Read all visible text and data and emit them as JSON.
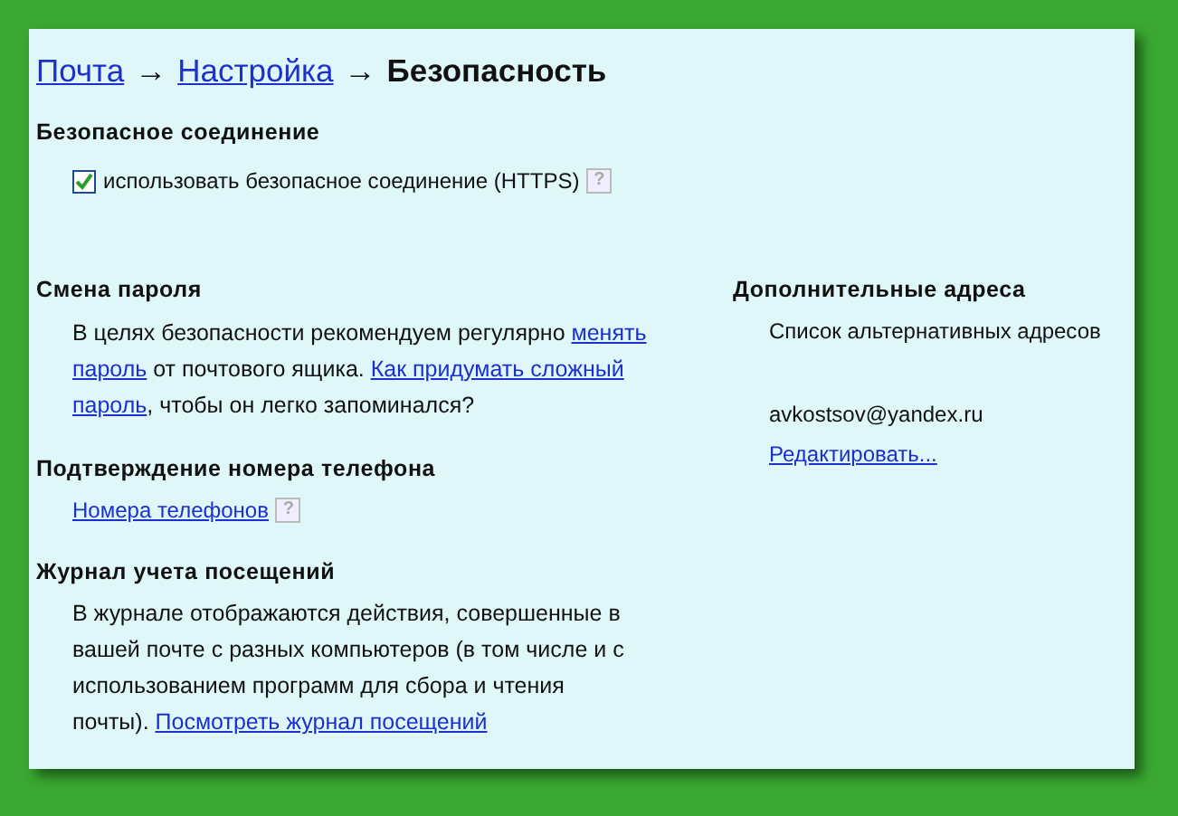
{
  "breadcrumb": [
    {
      "text": "Почта",
      "kind": "link"
    },
    {
      "text": "→",
      "kind": "separator"
    },
    {
      "text": "Настройка",
      "kind": "link"
    },
    {
      "text": "→",
      "kind": "separator"
    },
    {
      "text": "Безопасность",
      "kind": "current"
    }
  ],
  "secure_connection": {
    "heading": "Безопасное соединение",
    "checkbox": {
      "label": "использовать безопасное соединение (HTTPS)",
      "checked": true
    },
    "help": "?"
  },
  "password": {
    "heading": "Смена пароля",
    "paragraph": [
      [
        {
          "text": "В целях безопасности рекомендуем регулярно ",
          "kind": "text"
        },
        {
          "text": "менять",
          "kind": "link"
        }
      ],
      [
        {
          "text": "пароль",
          "kind": "link"
        },
        {
          "text": " от почтового ящика. ",
          "kind": "text"
        },
        {
          "text": "Как придумать сложный",
          "kind": "link"
        }
      ],
      [
        {
          "text": "пароль",
          "kind": "link"
        },
        {
          "text": ", чтобы он легко запоминался?",
          "kind": "text"
        }
      ]
    ]
  },
  "phone": {
    "heading": "Подтверждение номера телефона",
    "link": "Номера телефонов",
    "help": "?"
  },
  "visits": {
    "heading": "Журнал учета посещений",
    "paragraph": [
      [
        {
          "text": "В журнале отображаются действия, совершенные в",
          "kind": "text"
        }
      ],
      [
        {
          "text": "вашей почте с разных компьютеров (в том числе и с",
          "kind": "text"
        }
      ],
      [
        {
          "text": "использованием программ для сбора и чтения",
          "kind": "text"
        }
      ],
      [
        {
          "text": "почты). ",
          "kind": "text"
        },
        {
          "text": "Посмотреть журнал посещений",
          "kind": "link"
        }
      ]
    ]
  },
  "addresses": {
    "heading": "Дополнительные адреса",
    "description": "Список альтернативных адресов",
    "items": [
      "avkostsov@yandex.ru"
    ],
    "edit_link": "Редактировать..."
  }
}
